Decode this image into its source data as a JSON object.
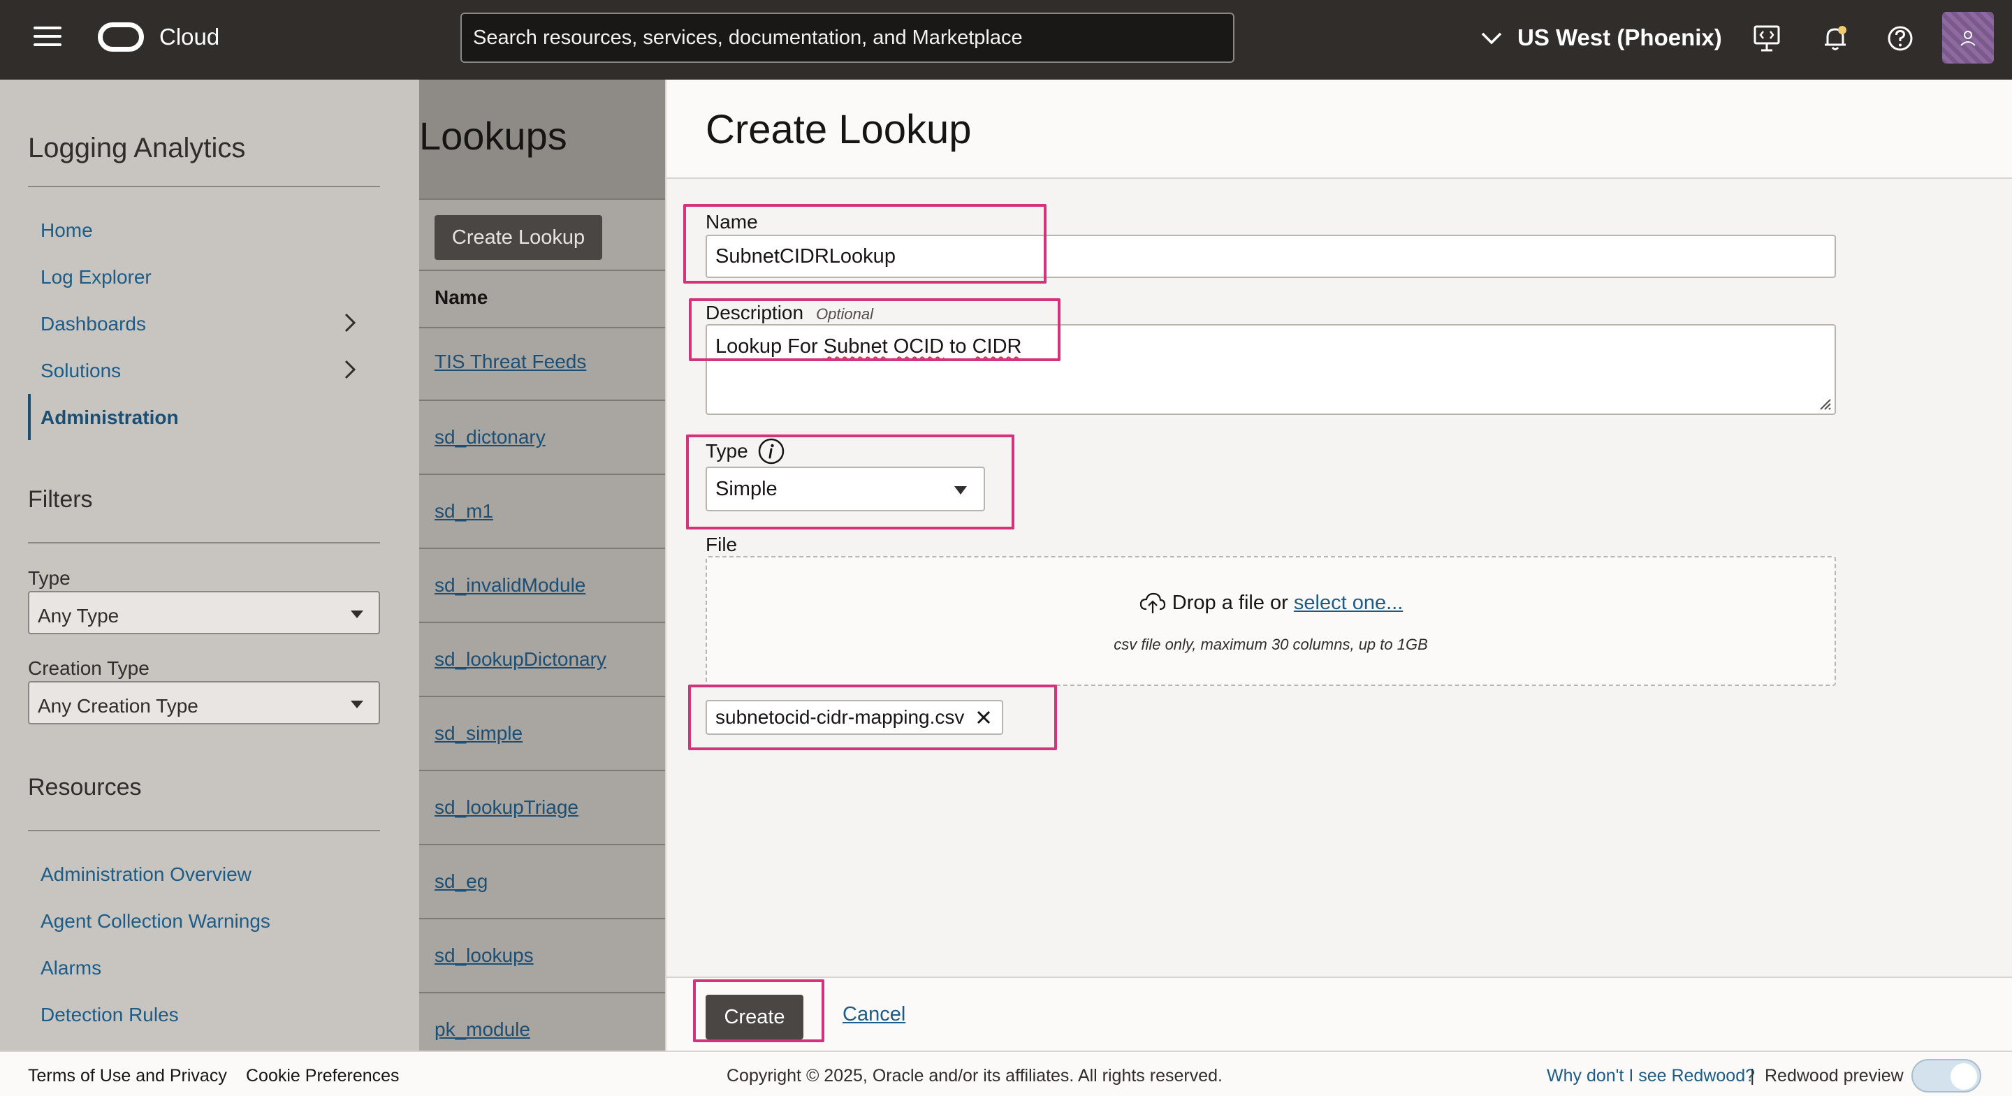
{
  "header": {
    "brand": "Cloud",
    "search_placeholder": "Search resources, services, documentation, and Marketplace",
    "region": "US West (Phoenix)",
    "icons": [
      "menu-icon",
      "developer-tools-icon",
      "bell-icon",
      "help-icon",
      "user-icon"
    ]
  },
  "sidebar": {
    "title": "Logging Analytics",
    "items": [
      {
        "label": "Home"
      },
      {
        "label": "Log Explorer"
      },
      {
        "label": "Dashboards"
      },
      {
        "label": "Solutions"
      },
      {
        "label": "Administration"
      }
    ],
    "active": "Administration",
    "filters": {
      "title": "Filters",
      "type_label": "Type",
      "type_value": "Any Type",
      "creation_label": "Creation Type",
      "creation_value": "Any Creation Type"
    },
    "resources": {
      "title": "Resources",
      "items": [
        {
          "label": "Administration Overview"
        },
        {
          "label": "Agent Collection Warnings"
        },
        {
          "label": "Alarms"
        },
        {
          "label": "Detection Rules"
        }
      ]
    }
  },
  "lookups": {
    "title": "Lookups",
    "create_button": "Create Lookup",
    "column_name": "Name",
    "rows": [
      {
        "name": "TIS Threat Feeds"
      },
      {
        "name": "sd_dictonary"
      },
      {
        "name": "sd_m1"
      },
      {
        "name": "sd_invalidModule"
      },
      {
        "name": "sd_lookupDictonary"
      },
      {
        "name": "sd_simple"
      },
      {
        "name": "sd_lookupTriage"
      },
      {
        "name": "sd_eg"
      },
      {
        "name": "sd_lookups"
      },
      {
        "name": "pk_module"
      }
    ]
  },
  "drawer": {
    "title": "Create Lookup",
    "name_label": "Name",
    "name_value": "SubnetCIDRLookup",
    "description_label": "Description",
    "description_optional": "Optional",
    "description_value": {
      "part1": "Lookup For ",
      "part2": "Subnet",
      "part3": " ",
      "part4": "OCID",
      "part5": " to  ",
      "part6": "CIDR"
    },
    "type_label": "Type",
    "type_value": "Simple",
    "file_label": "File",
    "drop_text": "Drop a file or",
    "drop_link": "select one...",
    "drop_hint": "csv file only, maximum 30 columns, up to 1GB",
    "file_chip": "subnetocid-cidr-mapping.csv",
    "create_button": "Create",
    "cancel_link": "Cancel",
    "highlight_color": "#d4337b"
  },
  "footer": {
    "terms": "Terms of Use and Privacy",
    "cookies": "Cookie Preferences",
    "copyright": "Copyright © 2025, Oracle and/or its affiliates. All rights reserved.",
    "redwood_question": "Why don't I see Redwood?",
    "separator": "|",
    "redwood_preview": "Redwood preview"
  }
}
